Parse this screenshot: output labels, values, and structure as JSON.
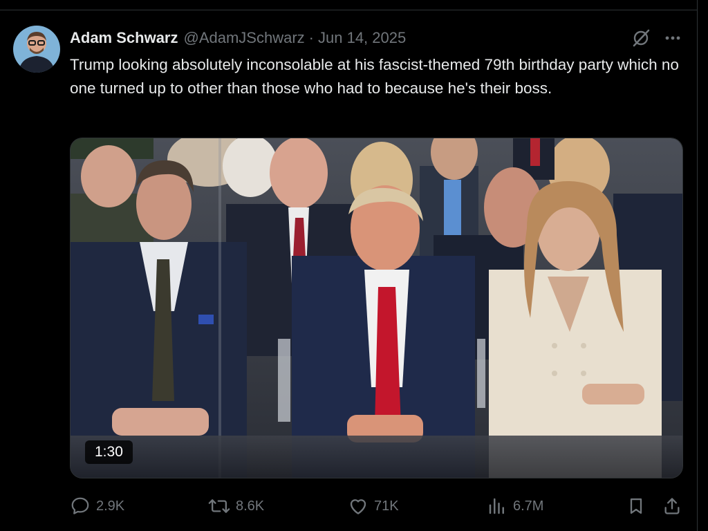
{
  "post": {
    "author": {
      "display_name": "Adam Schwarz",
      "handle": "@AdamJSchwarz",
      "separator": "·",
      "date": "Jun 14, 2025"
    },
    "text": "Trump looking absolutely inconsolable at his fascist-themed 79th birthday party which no one turned up to other than those who had to because he's their boss.",
    "media": {
      "type": "video",
      "duration": "1:30"
    },
    "actions": {
      "replies": "2.9K",
      "reposts": "8.6K",
      "likes": "71K",
      "views": "6.7M"
    }
  },
  "colors": {
    "background": "#000000",
    "text_primary": "#e7e9ea",
    "text_secondary": "#71767b",
    "divider": "#2f3336"
  },
  "icons": {
    "grok": "grok-icon",
    "more": "more-icon",
    "reply": "reply-icon",
    "repost": "repost-icon",
    "like": "like-icon",
    "views": "views-icon",
    "bookmark": "bookmark-icon",
    "share": "share-icon"
  }
}
